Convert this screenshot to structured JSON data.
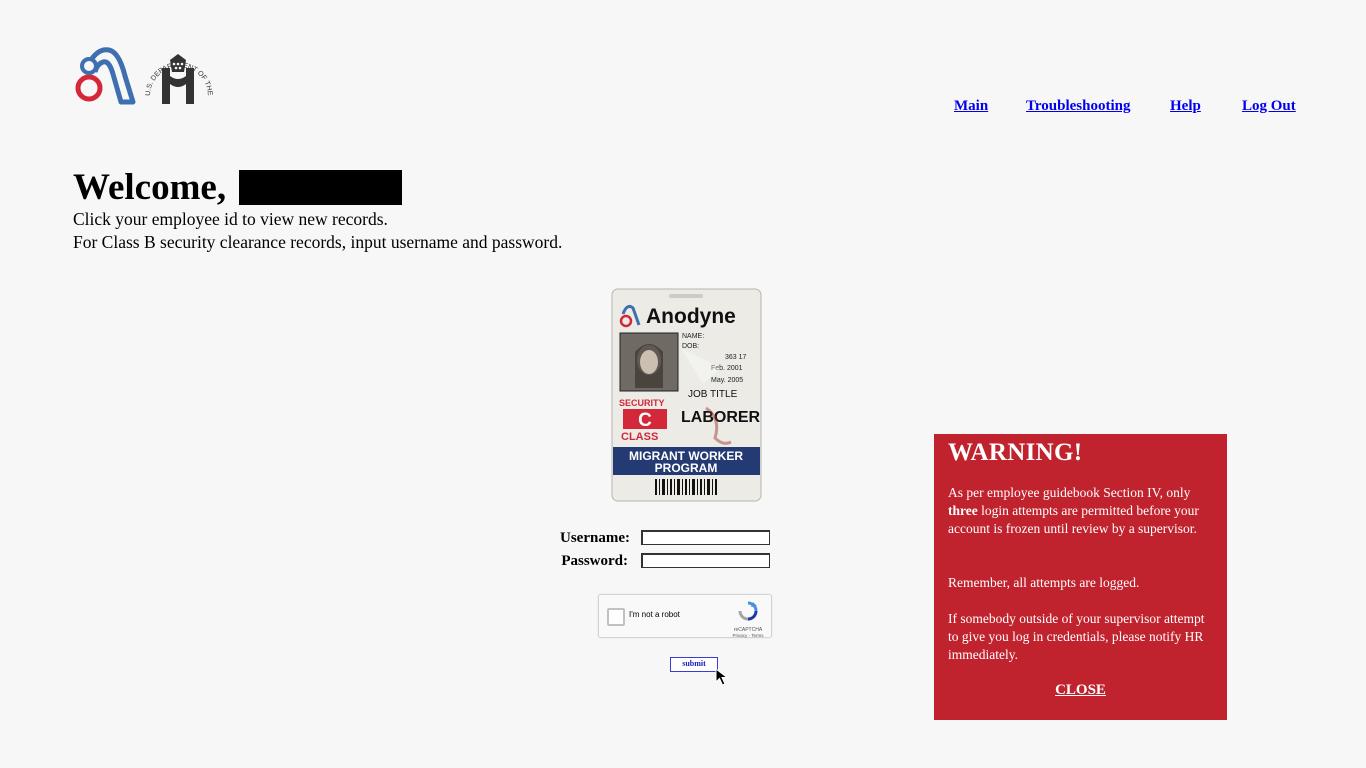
{
  "nav": {
    "main": "Main",
    "troubleshooting": "Troubleshooting",
    "help": "Help",
    "logout": "Log Out"
  },
  "header": {
    "welcome": "Welcome,",
    "seal_text": "U.S. DEPARTMENT OF THE INTERIOR"
  },
  "intro": {
    "line1": "Click your employee id to view new records.",
    "line2": "For Class B security clearance records, input username and password."
  },
  "badge": {
    "company": "Anodyne",
    "name_label": "NAME:",
    "dob_label": "DOB:",
    "id_number": "363 17",
    "issued": "Feb. 2001",
    "expires": "May. 2005",
    "job_title_label": "JOB TITLE",
    "job_title": "LABORER",
    "security_top": "SECURITY",
    "security_class": "C",
    "security_bottom": "CLASS",
    "program_line1": "MIGRANT WORKER",
    "program_line2": "PROGRAM"
  },
  "form": {
    "username_label": "Username:",
    "password_label": "Password:",
    "username_value": "",
    "password_value": "",
    "submit_label": "submit"
  },
  "captcha": {
    "label": "I'm not a robot",
    "brand": "reCAPTCHA",
    "terms": "Privacy - Terms"
  },
  "warning": {
    "title": "WARNING!",
    "p1_before": "As per employee guidebook Section IV, only ",
    "p1_bold": "three",
    "p1_after": " login attempts are permitted before your account is frozen until review by a supervisor.",
    "p2": "Remember, all attempts are logged.",
    "p3": "If somebody outside of your supervisor attempt to give you log in credentials, please notify HR immediately.",
    "close": "CLOSE"
  },
  "colors": {
    "warning_bg": "#c1232e",
    "link": "#0000ee",
    "brand_blue": "#3e6fb0",
    "brand_red": "#d3283a"
  }
}
